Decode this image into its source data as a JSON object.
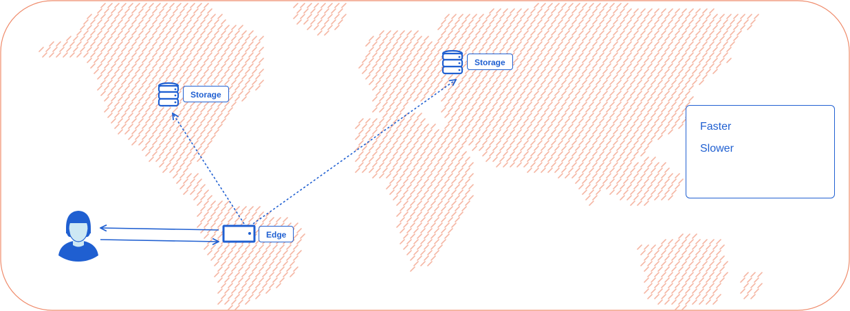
{
  "nodes": {
    "storage_left": {
      "label": "Storage"
    },
    "storage_right": {
      "label": "Storage"
    },
    "edge": {
      "label": "Edge"
    }
  },
  "legend": {
    "faster": {
      "label": "Faster"
    },
    "slower": {
      "label": "Slower"
    }
  },
  "colors": {
    "map_dash": "#f5b7a4",
    "border": "#ef8b6b",
    "accent": "#1f5fd1",
    "person_face": "#cde8f4",
    "person_body": "#1f5fd1"
  }
}
